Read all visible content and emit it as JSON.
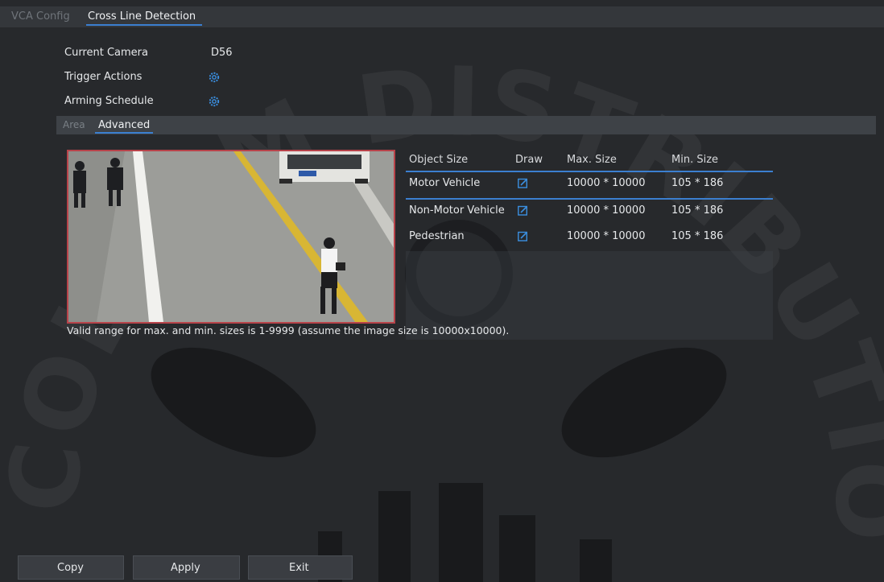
{
  "tabs": {
    "vca_config": "VCA Config",
    "cross_line_detection": "Cross Line Detection"
  },
  "settings": {
    "current_camera_label": "Current Camera",
    "current_camera_value": "D56",
    "trigger_actions_label": "Trigger Actions",
    "arming_schedule_label": "Arming Schedule"
  },
  "subtabs": {
    "area": "Area",
    "advanced": "Advanced"
  },
  "table": {
    "headers": {
      "name": "Object Size",
      "draw": "Draw",
      "max": "Max. Size",
      "min": "Min. Size"
    },
    "rows": [
      {
        "name": "Motor Vehicle",
        "max": "10000 * 10000",
        "min": "105 * 186"
      },
      {
        "name": "Non-Motor Vehicle",
        "max": "10000 * 10000",
        "min": "105 * 186"
      },
      {
        "name": "Pedestrian",
        "max": "10000 * 10000",
        "min": "105 * 186"
      }
    ]
  },
  "hint": "Valid range for max. and min. sizes is 1-9999 (assume the image size is 10000x10000).",
  "buttons": {
    "copy": "Copy",
    "apply": "Apply",
    "exit": "Exit"
  },
  "icons": {
    "trigger": "gear-icon",
    "schedule": "gear-icon",
    "draw": "edit-icon"
  },
  "colors": {
    "accent": "#3b7fd0",
    "preview_border": "#b8434a",
    "background": "#27292c"
  },
  "watermark": "COLSAM DISTRIBUTION, INC"
}
